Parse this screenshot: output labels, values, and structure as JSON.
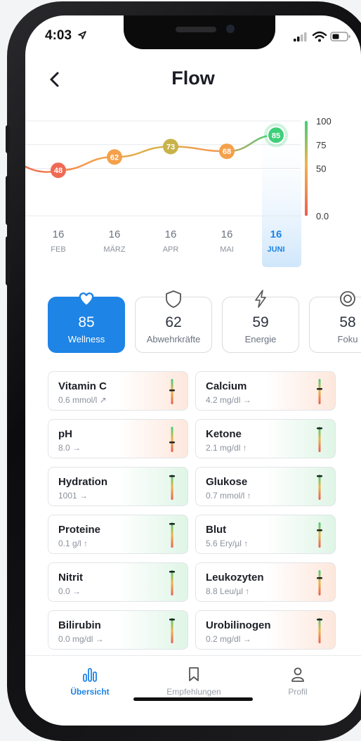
{
  "status": {
    "time": "4:03"
  },
  "header": {
    "title": "Flow",
    "back_icon": "chevron-left-icon"
  },
  "chart_data": {
    "type": "line",
    "x": [
      "16 FEB",
      "16 MÄRZ",
      "16 APR",
      "16 MAI",
      "16 JUNI"
    ],
    "series": [
      {
        "values": [
          48,
          62,
          73,
          68,
          85
        ]
      }
    ],
    "point_labels": [
      "48",
      "62",
      "73",
      "68",
      "85"
    ],
    "ylim": [
      0,
      100
    ],
    "y_ticks": [
      "0.0",
      "50",
      "75",
      "100"
    ],
    "selected_index": 4,
    "colors": {
      "low": "#ef6a55",
      "mid": "#f5a04a",
      "ok": "#c7b34a",
      "high": "#3fcf79"
    }
  },
  "dates": [
    {
      "day": "16",
      "month": "FEB"
    },
    {
      "day": "16",
      "month": "MÄRZ"
    },
    {
      "day": "16",
      "month": "APR"
    },
    {
      "day": "16",
      "month": "MAI"
    },
    {
      "day": "16",
      "month": "JUNI"
    }
  ],
  "tiles": [
    {
      "value": "85",
      "label": "Wellness",
      "icon": "heart-icon",
      "active": true
    },
    {
      "value": "62",
      "label": "Abwehrkräfte",
      "icon": "shield-icon",
      "active": false
    },
    {
      "value": "59",
      "label": "Energie",
      "icon": "lightning-icon",
      "active": false
    },
    {
      "value": "58",
      "label": "Foku",
      "icon": "target-icon",
      "active": false
    }
  ],
  "cards": [
    {
      "name": "Vitamin C",
      "value": "0.6 mmol/l ↗",
      "tone": "warm",
      "gauge_level": 0.55
    },
    {
      "name": "Calcium",
      "value": "4.2 mg/dl →",
      "tone": "warm",
      "gauge_level": 0.6
    },
    {
      "name": "pH",
      "value": "8.0 →",
      "tone": "warm",
      "gauge_level": 0.4
    },
    {
      "name": "Ketone",
      "value": "2.1 mg/dl ↑",
      "tone": "cool",
      "gauge_level": 0.95
    },
    {
      "name": "Hydration",
      "value": "1001 →",
      "tone": "cool",
      "gauge_level": 0.95
    },
    {
      "name": "Glukose",
      "value": "0.7 mmol/l ↑",
      "tone": "cool",
      "gauge_level": 0.95
    },
    {
      "name": "Proteine",
      "value": "0.1 g/l ↑",
      "tone": "cool",
      "gauge_level": 0.95
    },
    {
      "name": "Blut",
      "value": "5.6 Ery/µl ↑",
      "tone": "cool",
      "gauge_level": 0.7
    },
    {
      "name": "Nitrit",
      "value": "0.0 →",
      "tone": "cool",
      "gauge_level": 0.95
    },
    {
      "name": "Leukozyten",
      "value": "8.8 Leu/µl ↑",
      "tone": "warm",
      "gauge_level": 0.7
    },
    {
      "name": "Bilirubin",
      "value": "0.0 mg/dl →",
      "tone": "cool",
      "gauge_level": 0.95
    },
    {
      "name": "Urobilinogen",
      "value": "0.2 mg/dl →",
      "tone": "warm",
      "gauge_level": 0.95
    }
  ],
  "nav": [
    {
      "label": "Übersicht",
      "icon": "bar-chart-icon",
      "active": true
    },
    {
      "label": "Empfehlungen",
      "icon": "bookmark-icon",
      "active": false
    },
    {
      "label": "Profil",
      "icon": "person-icon",
      "active": false
    }
  ],
  "accent": "#1e84e6"
}
